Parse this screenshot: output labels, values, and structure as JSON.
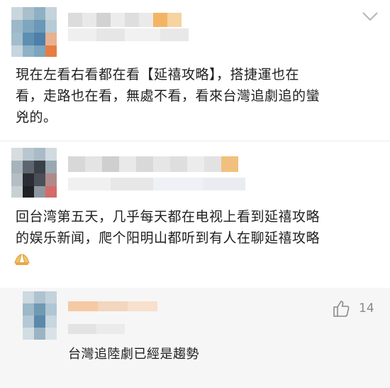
{
  "comments": [
    {
      "text_lines": [
        "現在左看右看都在看【延禧攻略】，搭捷運也在",
        "看，走路也在看，無處不看，看來台灣追劇追的蠻",
        "兇的。"
      ]
    },
    {
      "text_lines": [
        "回台湾第五天，几乎每天都在电视上看到延禧攻略",
        "的娱乐新闻，爬个阳明山都听到有人在聊延禧攻略"
      ],
      "emoji": "praying-hands"
    }
  ],
  "reply": {
    "text": "台灣追陸劇已經是趨勢",
    "like_count": "14"
  },
  "icons": {
    "more": "chevron-down-icon",
    "like": "thumbs-up-icon"
  },
  "colors": {
    "reply_background": "#f6f6f6",
    "meta_text": "#8a8a8a"
  }
}
